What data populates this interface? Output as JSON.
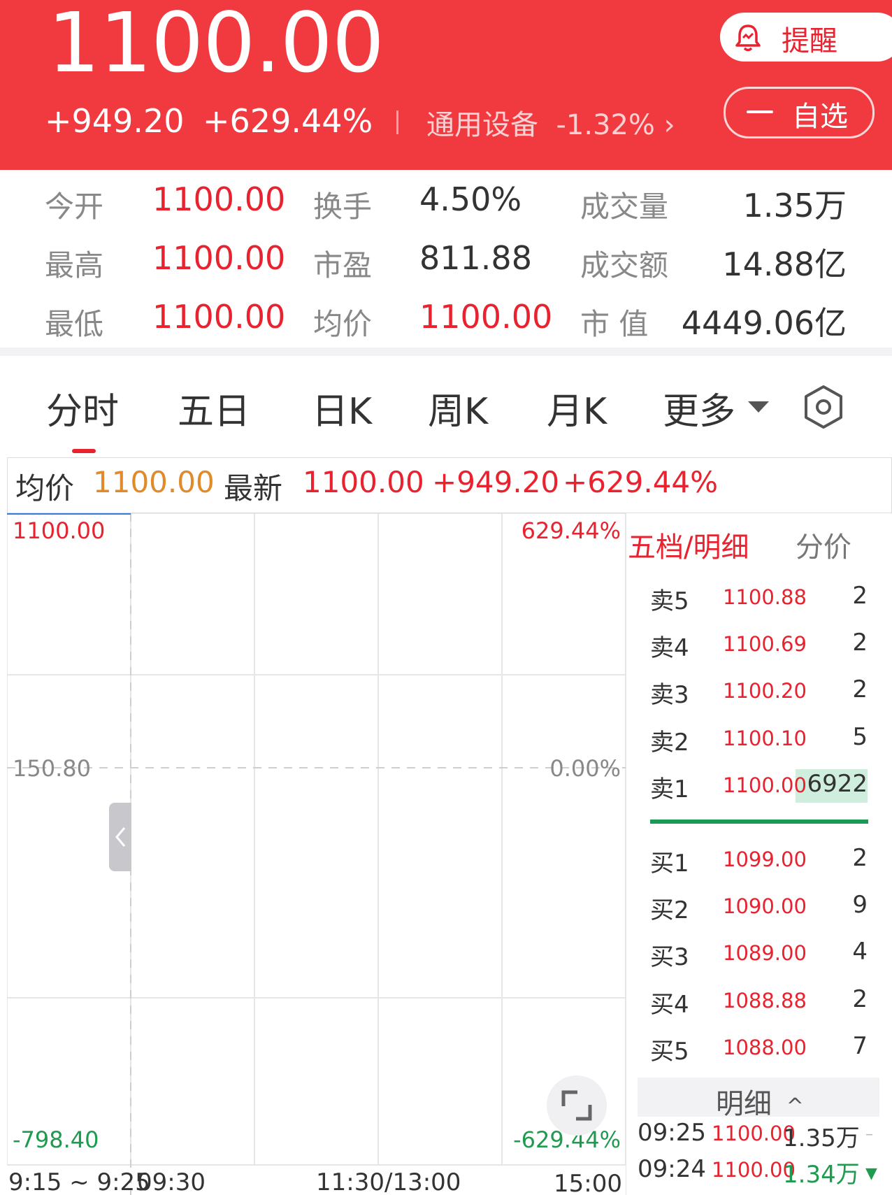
{
  "header": {
    "price": "1100.00",
    "change_abs": "+949.20",
    "change_pct": "+629.44%",
    "sector": "通用设备",
    "sector_change": "-1.32%",
    "alert_label": "提醒",
    "watch_label": "自选"
  },
  "stats": [
    [
      {
        "label": "今开",
        "value": "1100.00",
        "color": "red"
      },
      {
        "label": "换手",
        "value": "4.50%",
        "color": "dark"
      },
      {
        "label": "成交量",
        "value": "1.35万",
        "color": "dark"
      }
    ],
    [
      {
        "label": "最高",
        "value": "1100.00",
        "color": "red"
      },
      {
        "label": "市盈",
        "value": "811.88",
        "color": "dark"
      },
      {
        "label": "成交额",
        "value": "14.88亿",
        "color": "dark"
      }
    ],
    [
      {
        "label": "最低",
        "value": "1100.00",
        "color": "red"
      },
      {
        "label": "均价",
        "value": "1100.00",
        "color": "red"
      },
      {
        "label": "市 值",
        "value": "4449.06亿",
        "color": "dark"
      }
    ]
  ],
  "tabs": [
    "分时",
    "五日",
    "日K",
    "周K",
    "月K",
    "更多"
  ],
  "active_tab": "分时",
  "info_bar": {
    "avg_label": "均价",
    "avg_value": "1100.00",
    "latest_label": "最新",
    "latest_value": "1100.00",
    "latest_change": "+949.20",
    "latest_pct": "+629.44%"
  },
  "chart_data": {
    "type": "line",
    "y_left_labels": [
      "1100.00",
      "150.80",
      "-798.40"
    ],
    "y_right_labels": [
      "629.44%",
      "0.00%",
      "-629.44%"
    ],
    "x_labels": [
      "9:15 ~ 9:25",
      "09:30",
      "11:30/13:00",
      "15:00"
    ],
    "ylim": [
      -798.4,
      1100.0
    ],
    "grid": true
  },
  "order_book": {
    "title": "五档/明细",
    "tab2": "分价",
    "asks": [
      {
        "label": "卖5",
        "price": "1100.88",
        "vol": "2"
      },
      {
        "label": "卖4",
        "price": "1100.69",
        "vol": "2"
      },
      {
        "label": "卖3",
        "price": "1100.20",
        "vol": "2"
      },
      {
        "label": "卖2",
        "price": "1100.10",
        "vol": "5"
      },
      {
        "label": "卖1",
        "price": "1100.00",
        "vol": "6922"
      }
    ],
    "bids": [
      {
        "label": "买1",
        "price": "1099.00",
        "vol": "2"
      },
      {
        "label": "买2",
        "price": "1090.00",
        "vol": "9"
      },
      {
        "label": "买3",
        "price": "1089.00",
        "vol": "4"
      },
      {
        "label": "买4",
        "price": "1088.88",
        "vol": "2"
      },
      {
        "label": "买5",
        "price": "1088.00",
        "vol": "7"
      }
    ],
    "detail_label": "明细",
    "ticks": [
      {
        "time": "09:25",
        "price": "1100.00",
        "vol": "1.35万",
        "vol_color": "dark"
      },
      {
        "time": "09:24",
        "price": "1100.00",
        "vol": "1.34万",
        "vol_color": "green"
      }
    ]
  },
  "colors": {
    "header_bg": "#f03a3f",
    "up": "#e8222e",
    "down": "#1f9b4f",
    "avg": "#e08a2a"
  }
}
